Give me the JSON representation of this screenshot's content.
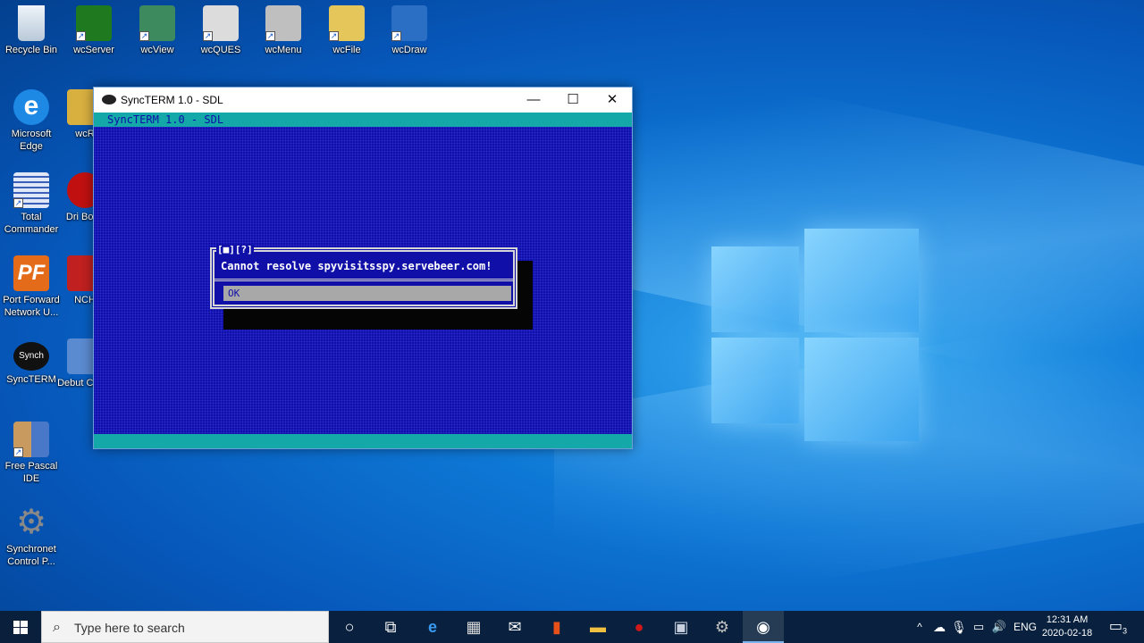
{
  "desktop": {
    "icons": [
      {
        "label": "Recycle Bin",
        "icon": "recycle-bin-icon",
        "color": "#dfe8f0"
      },
      {
        "label": "wcServer",
        "icon": "wcserver-icon",
        "color": "#1f7a1f"
      },
      {
        "label": "wcView",
        "icon": "wcview-icon",
        "color": "#3d8a5e"
      },
      {
        "label": "wcQUES",
        "icon": "wcques-icon",
        "color": "#dcdcdc"
      },
      {
        "label": "wcMenu",
        "icon": "wcmenu-icon",
        "color": "#bfbfbf"
      },
      {
        "label": "wcFile",
        "icon": "wcfile-icon",
        "color": "#e5c65a"
      },
      {
        "label": "wcDraw",
        "icon": "wcdraw-icon",
        "color": "#2a6fc4"
      },
      {
        "label": "Microsoft Edge",
        "icon": "edge-icon",
        "color": "#1e88e5"
      },
      {
        "label": "Total Commander",
        "icon": "total-commander-icon",
        "color": "#e0e8f8"
      },
      {
        "label": "Port Forward Network U...",
        "icon": "portforward-icon",
        "color": "#e36b1a"
      },
      {
        "label": "SyncTERM",
        "icon": "syncterm-icon",
        "color": "#111111"
      },
      {
        "label": "Free Pascal IDE",
        "icon": "free-pascal-icon",
        "color": "#4a78c8"
      },
      {
        "label": "Synchronet Control P...",
        "icon": "synchronet-gear-icon",
        "color": "#9a9a9a"
      },
      {
        "label": "wcR",
        "icon": "wcr-icon",
        "color": "#d8b040"
      },
      {
        "label": "Dri Boos",
        "icon": "driver-booster-icon",
        "color": "#c01010"
      },
      {
        "label": "NCH",
        "icon": "nch-icon",
        "color": "#c02020"
      },
      {
        "label": "Debut Captu",
        "icon": "debut-icon",
        "color": "#5a8ad0"
      }
    ]
  },
  "window": {
    "title": "SyncTERM 1.0 - SDL",
    "minimize": "—",
    "maximize": "☐",
    "close": "✕"
  },
  "terminal": {
    "status_line": "SyncTERM 1.0 - SDL",
    "dialog": {
      "title": "[■][?]",
      "message": "Cannot resolve spyvisitsspy.servebeer.com!",
      "ok": "OK"
    }
  },
  "taskbar": {
    "search_placeholder": "Type here to search",
    "apps": [
      {
        "icon": "cortana-icon",
        "glyph": "○"
      },
      {
        "icon": "task-view-icon",
        "glyph": "⧉"
      },
      {
        "icon": "edge-icon",
        "glyph": "e"
      },
      {
        "icon": "store-icon",
        "glyph": "▦"
      },
      {
        "icon": "mail-icon",
        "glyph": "✉"
      },
      {
        "icon": "office-icon",
        "glyph": "▮"
      },
      {
        "icon": "file-explorer-icon",
        "glyph": "▬"
      },
      {
        "icon": "driver-booster-icon",
        "glyph": "●"
      },
      {
        "icon": "total-commander-icon",
        "glyph": "▣"
      },
      {
        "icon": "synchronet-gear-icon",
        "glyph": "⚙"
      },
      {
        "icon": "syncterm-icon",
        "glyph": "◉"
      }
    ],
    "tray": {
      "chevron": "^",
      "language": "ENG",
      "time": "12:31 AM",
      "date": "2020-02-18",
      "notifications": "3"
    }
  },
  "colors": {
    "terminal_bg": "#1010a8",
    "terminal_bar": "#14a8a8",
    "button_grey": "#a8a8a8",
    "accent": "#0078d7"
  }
}
